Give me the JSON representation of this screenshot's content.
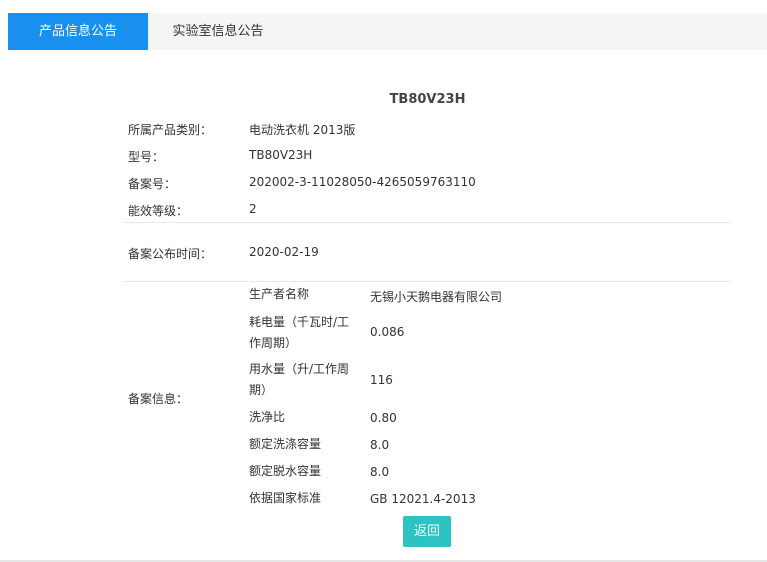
{
  "tabs": [
    {
      "label": "产品信息公告",
      "active": true
    },
    {
      "label": "实验室信息公告",
      "active": false
    }
  ],
  "product": {
    "title": "TB80V23H",
    "category_label": "所属产品类别：",
    "category_value": "电动洗衣机 2013版",
    "model_label": "型号：",
    "model_value": "TB80V23H",
    "record_no_label": "备案号：",
    "record_no_value": "202002-3-11028050-4265059763110",
    "energy_grade_label": "能效等级：",
    "energy_grade_value": "2",
    "publish_time_label": "备案公布时间：",
    "publish_time_value": "2020-02-19",
    "record_info_label": "备案信息："
  },
  "record_info": [
    {
      "label": "生产者名称",
      "value": "无锡小天鹅电器有限公司"
    },
    {
      "label": "耗电量（千瓦时/工作周期）",
      "value": "0.086"
    },
    {
      "label": "用水量（升/工作周期）",
      "value": "116"
    },
    {
      "label": "洗净比",
      "value": "0.80"
    },
    {
      "label": "额定洗涤容量",
      "value": "8.0"
    },
    {
      "label": "额定脱水容量",
      "value": "8.0"
    },
    {
      "label": "依据国家标准",
      "value": "GB 12021.4-2013"
    }
  ],
  "back_button": "返回",
  "colors": {
    "tab_active": "#1890f0",
    "button": "#2ec3c3"
  }
}
